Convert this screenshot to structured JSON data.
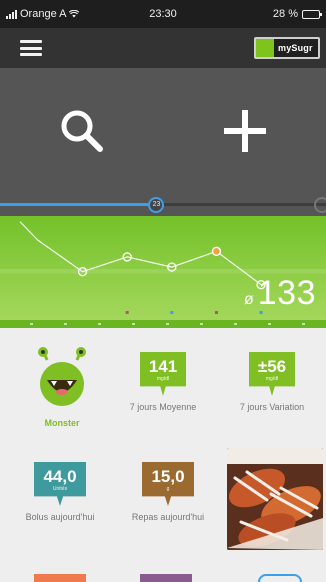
{
  "status_bar": {
    "carrier": "Orange A",
    "time": "23:30",
    "battery": "28 %",
    "battery_level": 0.28
  },
  "toolbar": {
    "menu_icon": "hamburger-menu-icon",
    "logo_text": "mySugr",
    "brand_color": "#7fc31d"
  },
  "actions": [
    {
      "icon": "search-icon"
    },
    {
      "icon": "plus-icon"
    }
  ],
  "timeline": {
    "thumb_label": "23",
    "position": 0.48,
    "accent": "#3aa0ea"
  },
  "chart_data": {
    "type": "line",
    "x": [
      1,
      2,
      3,
      4,
      5,
      6
    ],
    "values": [
      181,
      147,
      163,
      152,
      169,
      133
    ],
    "highlight_index": 4,
    "event_markers": [
      3,
      4,
      5,
      6
    ],
    "ylim": [
      110,
      205
    ],
    "xlabel": "",
    "ylabel": "",
    "title": ""
  },
  "current_reading": {
    "symbol": "ø",
    "value": "133"
  },
  "tiles": {
    "monster": {
      "label": "Monster",
      "icon": "monster-icon"
    },
    "average": {
      "value": "141",
      "unit": "mg/dl",
      "label": "7 jours Moyenne",
      "color": "#7fbf24"
    },
    "variation": {
      "value": "±56",
      "unit": "mg/dl",
      "label": "7 jours Variation",
      "color": "#7fbf24"
    },
    "bolus": {
      "value": "44,0",
      "unit": "Unités",
      "label": "Bolus aujourd'hui",
      "color": "#3e9a9c"
    },
    "meals": {
      "value": "15,0",
      "unit": "g",
      "label": "Repas aujourd'hui",
      "color": "#9a6a30"
    },
    "photo": {
      "icon": "food-photo-icon"
    }
  },
  "bottom_tiles": [
    "#ef7a4e",
    "#8a5b8e",
    "#3aa0ea"
  ]
}
